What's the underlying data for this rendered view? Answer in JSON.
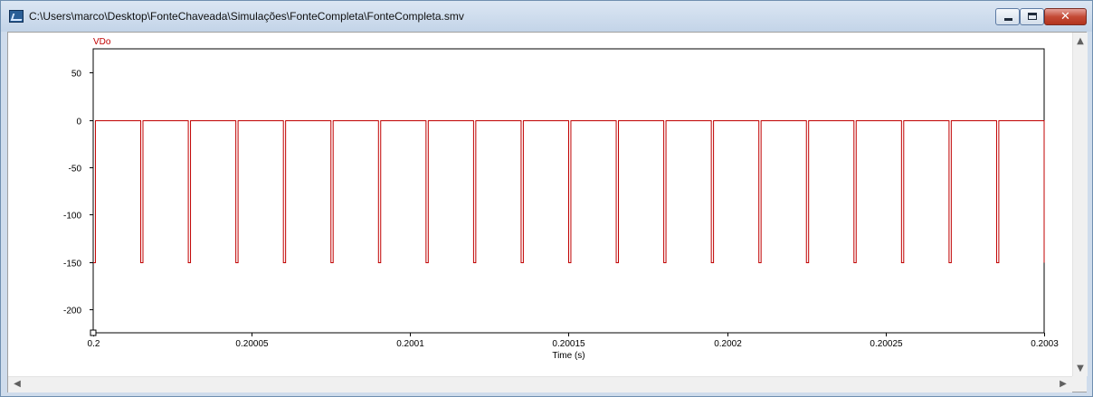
{
  "window": {
    "title": "C:\\Users\\marco\\Desktop\\FonteChaveada\\Simulações\\FonteCompleta\\FonteCompleta.smv",
    "close_glyph": "✕"
  },
  "icons": {
    "app": "waveform-viewer-icon",
    "minimize": "minimize-icon",
    "maximize": "maximize-icon",
    "close": "close-icon",
    "scroll_up": "chevron-up-icon",
    "scroll_down": "chevron-down-icon",
    "scroll_left": "chevron-left-icon",
    "scroll_right": "chevron-right-icon"
  },
  "scroll": {
    "up": "▲",
    "down": "▼",
    "left": "◀",
    "right": "▶"
  },
  "chart_data": {
    "type": "line",
    "series": [
      {
        "name": "VDo",
        "color": "#c00000",
        "high": 0,
        "low": -150,
        "low_starts": [
          0.2,
          0.200015,
          0.20003,
          0.200045,
          0.20006,
          0.200075,
          0.20009,
          0.200105,
          0.20012,
          0.200135,
          0.20015,
          0.200165,
          0.20018,
          0.200195,
          0.20021,
          0.200225,
          0.20024,
          0.200255,
          0.20027,
          0.200285,
          0.2003
        ],
        "low_duration": 7e-07
      }
    ],
    "xlabel": "Time (s)",
    "xlim": [
      0.2,
      0.2003
    ],
    "ylim": [
      -225,
      75
    ],
    "x_ticks": [
      "0.2",
      "0.20005",
      "0.2001",
      "0.20015",
      "0.2002",
      "0.20025",
      "0.2003"
    ],
    "x_tick_values": [
      0.2,
      0.20005,
      0.2001,
      0.20015,
      0.2002,
      0.20025,
      0.2003
    ],
    "y_ticks": [
      "50",
      "0",
      "-50",
      "-100",
      "-150",
      "-200"
    ],
    "y_tick_values": [
      50,
      0,
      -50,
      -100,
      -150,
      -200
    ],
    "grid": true,
    "grid_color": "#808080"
  }
}
